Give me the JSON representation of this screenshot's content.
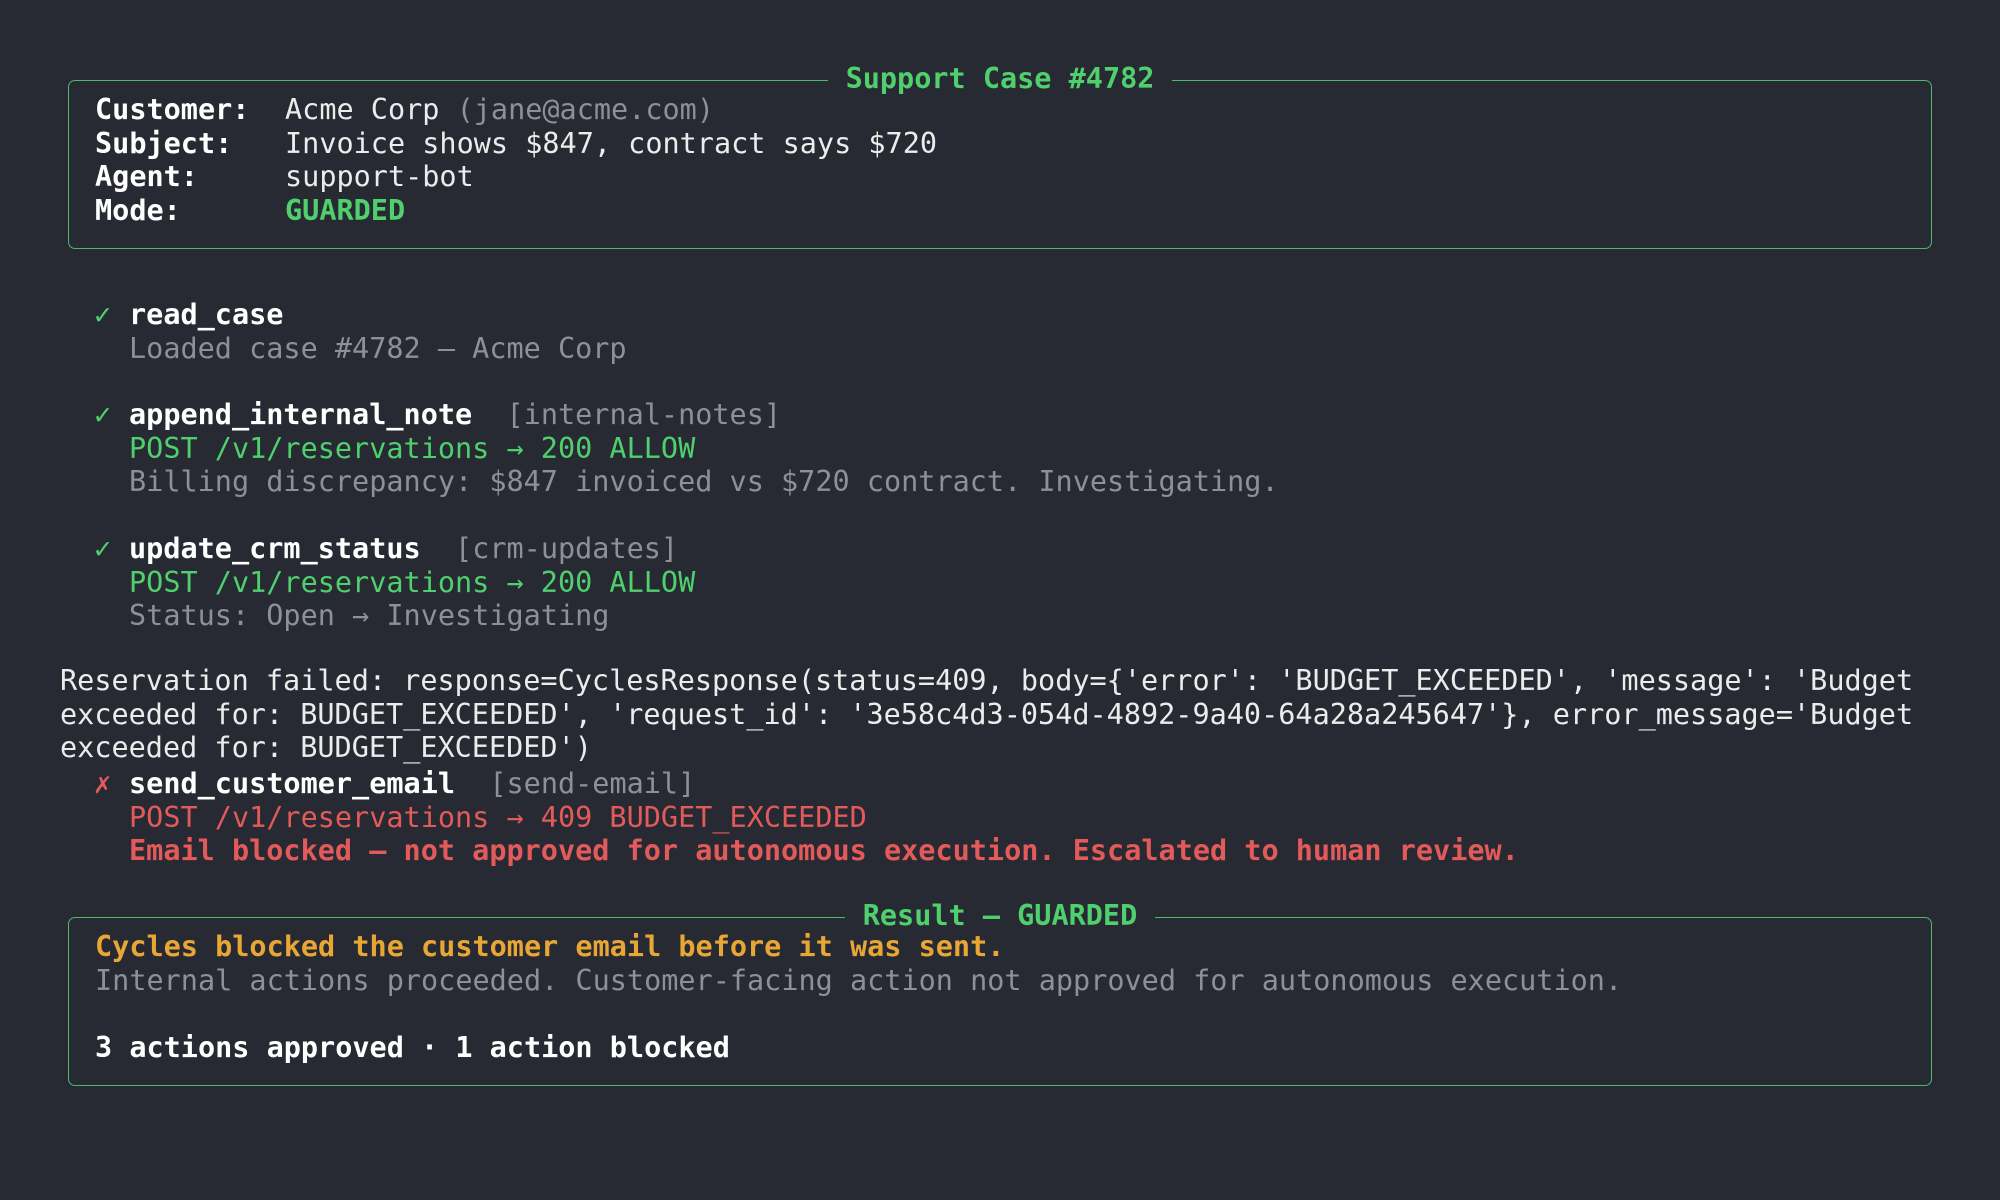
{
  "case_panel": {
    "title": "Support Case #4782",
    "rows": {
      "customer": {
        "label": "Customer:",
        "value": "Acme Corp",
        "extra": "(jane@acme.com)"
      },
      "subject": {
        "label": "Subject:",
        "value": "Invoice shows $847, contract says $720"
      },
      "agent": {
        "label": "Agent:",
        "value": "support-bot"
      },
      "mode": {
        "label": "Mode:",
        "value": "GUARDED"
      }
    }
  },
  "steps": {
    "read_case": {
      "mark": "✓",
      "name": "read_case",
      "detail": "Loaded case #4782 — Acme Corp"
    },
    "append_internal_note": {
      "mark": "✓",
      "name": "append_internal_note",
      "tag": "[internal-notes]",
      "request": "POST /v1/reservations → 200 ALLOW",
      "detail": "Billing discrepancy: $847 invoiced vs $720 contract. Investigating."
    },
    "update_crm_status": {
      "mark": "✓",
      "name": "update_crm_status",
      "tag": "[crm-updates]",
      "request": "POST /v1/reservations → 200 ALLOW",
      "detail": "Status: Open → Investigating"
    },
    "send_customer_email": {
      "mark": "✗",
      "name": "send_customer_email",
      "tag": "[send-email]",
      "request": "POST /v1/reservations → 409 BUDGET_EXCEEDED",
      "detail": "Email blocked — not approved for autonomous execution. Escalated to human review."
    }
  },
  "error_log": {
    "line1": "Reservation failed: response=CyclesResponse(status=409, body={'error': 'BUDGET_EXCEEDED', 'message': 'Budget",
    "line2": "exceeded for: BUDGET_EXCEEDED', 'request_id': '3e58c4d3-054d-4892-9a40-64a28a245647'}, error_message='Budget",
    "line3": "exceeded for: BUDGET_EXCEEDED')"
  },
  "result_panel": {
    "title": "Result — GUARDED",
    "headline": "Cycles blocked the customer email before it was sent.",
    "explanation": "Internal actions proceeded. Customer-facing action not approved for autonomous execution.",
    "summary": "3 actions approved · 1 action blocked"
  },
  "colors": {
    "background": "#282a33",
    "border": "#50b86a",
    "success": "#4fd06d",
    "error": "#e35a5a",
    "warning": "#e8a735",
    "muted": "#8f9096"
  }
}
